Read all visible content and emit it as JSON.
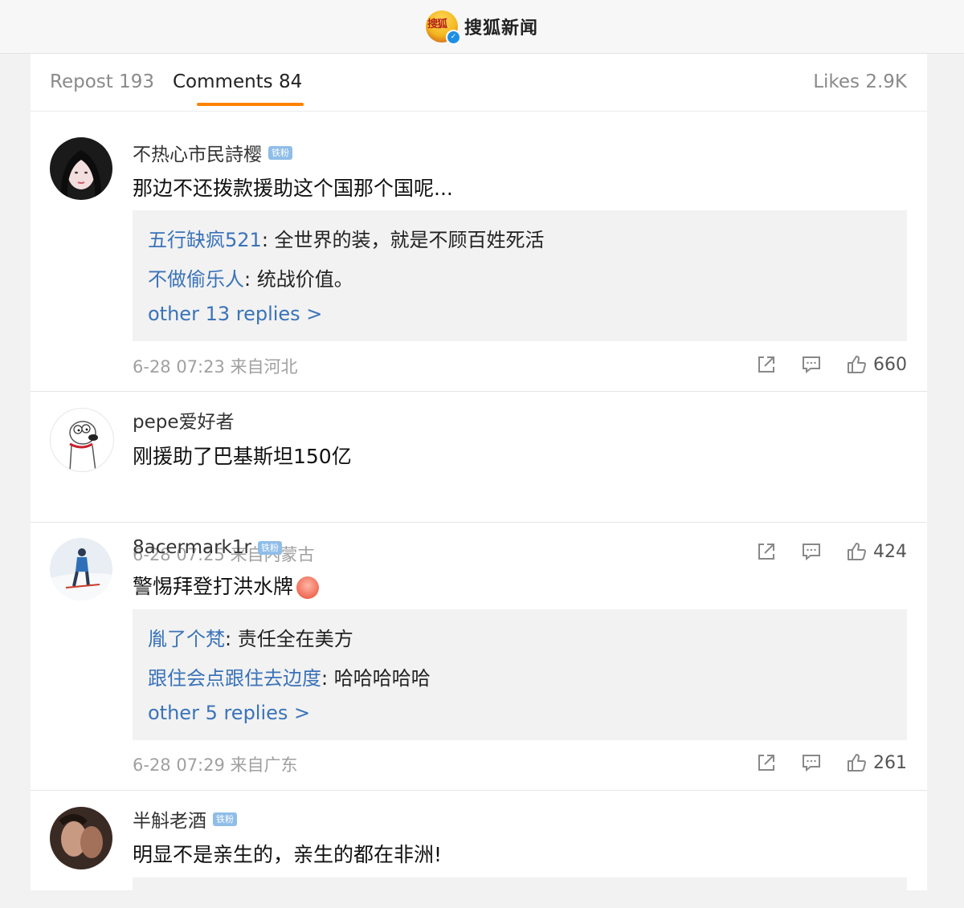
{
  "header": {
    "logo_text": "搜狐",
    "app_title": "搜狐新闻",
    "verified_icon": "verified-check-icon"
  },
  "tabs": {
    "repost": "Repost 193",
    "comments": "Comments 84",
    "likes": "Likes 2.9K"
  },
  "comments": [
    {
      "user": "不热心市民詩樱",
      "badge": "铁粉",
      "text": "那边不还拨款援助这个国那个国呢...",
      "replies": [
        {
          "user": "五行缺疯521",
          "text": ": 全世界的装，就是不顾百姓死活"
        },
        {
          "user": "不做偷乐人",
          "text": ": 统战价值。"
        }
      ],
      "more": "other 13 replies >",
      "time": "6-28 07:23 来自河北",
      "likes": "660"
    },
    {
      "user": "pepe爱好者",
      "badge": "",
      "text": "刚援助了巴基斯坦150亿",
      "replies": [],
      "more": "",
      "time": "6-28 07:25 来自内蒙古",
      "likes": "424"
    },
    {
      "user": "8acermark1r",
      "badge": "铁粉",
      "text": "警惕拜登打洪水牌",
      "replies": [
        {
          "user": "胤了个梵",
          "text": ": 责任全在美方"
        },
        {
          "user": "跟住会点跟住去边度",
          "text": ": 哈哈哈哈哈"
        }
      ],
      "more": "other 5 replies >",
      "time": "6-28 07:29 来自广东",
      "likes": "261"
    },
    {
      "user": "半斛老酒",
      "badge": "铁粉",
      "text": "明显不是亲生的，亲生的都在非洲!",
      "replies": [],
      "more": "",
      "time": "",
      "likes": ""
    }
  ],
  "icons": {
    "repost": "share-out-icon",
    "comment": "comment-bubble-icon",
    "like": "thumbs-up-icon"
  },
  "colors": {
    "accent": "#ff8200",
    "link": "#3a73b8",
    "badge": "#8fbde8"
  }
}
